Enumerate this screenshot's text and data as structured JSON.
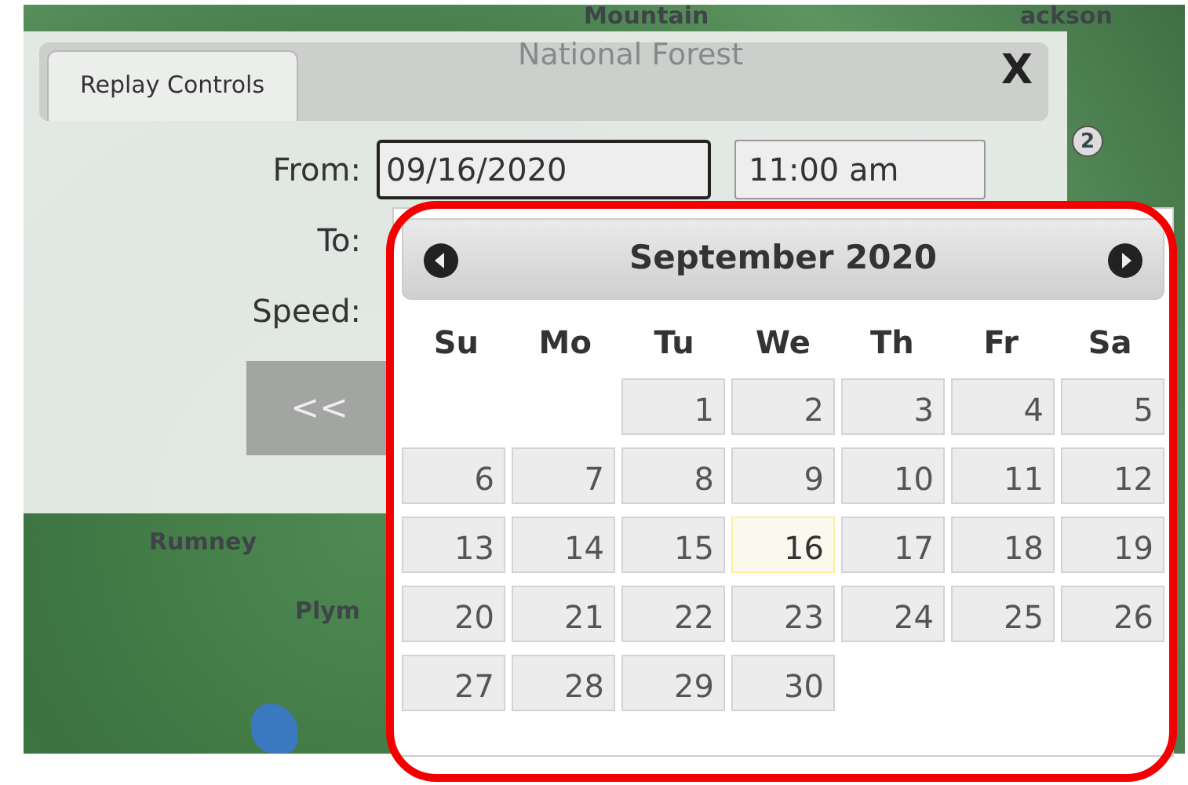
{
  "map": {
    "labels": [
      {
        "text": "Mountain",
        "kind": "place"
      },
      {
        "text": "National Forest",
        "kind": "area"
      },
      {
        "text": "ackson",
        "kind": "place"
      },
      {
        "text": "2",
        "kind": "shield"
      },
      {
        "text": "Rumney",
        "kind": "place"
      },
      {
        "text": "Plym",
        "kind": "place"
      }
    ]
  },
  "dialog": {
    "tabs": [
      {
        "label": "Replay Controls",
        "selected": true
      }
    ],
    "close": "X",
    "fields": [
      {
        "label": "From:",
        "date": "09/16/2020",
        "time": "11:00 am",
        "focused": true
      },
      {
        "label": "To:"
      },
      {
        "label": "Speed:"
      }
    ],
    "buttons": [
      "<<"
    ]
  },
  "datepicker": {
    "title": "September 2020",
    "weekdays": [
      "Su",
      "Mo",
      "Tu",
      "We",
      "Th",
      "Fr",
      "Sa"
    ],
    "weeks": [
      [
        {
          "kind": "empty"
        },
        {
          "kind": "empty"
        },
        {
          "day": "1",
          "selected": false
        },
        {
          "day": "2",
          "selected": false
        },
        {
          "day": "3",
          "selected": false
        },
        {
          "day": "4",
          "selected": false
        },
        {
          "day": "5",
          "selected": false
        }
      ],
      [
        {
          "day": "6",
          "selected": false
        },
        {
          "day": "7",
          "selected": false
        },
        {
          "day": "8",
          "selected": false
        },
        {
          "day": "9",
          "selected": false
        },
        {
          "day": "10",
          "selected": false
        },
        {
          "day": "11",
          "selected": false
        },
        {
          "day": "12",
          "selected": false
        }
      ],
      [
        {
          "day": "13",
          "selected": false
        },
        {
          "day": "14",
          "selected": false
        },
        {
          "day": "15",
          "selected": false
        },
        {
          "day": "16",
          "selected": true
        },
        {
          "day": "17",
          "selected": false
        },
        {
          "day": "18",
          "selected": false
        },
        {
          "day": "19",
          "selected": false
        }
      ],
      [
        {
          "day": "20",
          "selected": false
        },
        {
          "day": "21",
          "selected": false
        },
        {
          "day": "22",
          "selected": false
        },
        {
          "day": "23",
          "selected": false
        },
        {
          "day": "24",
          "selected": false
        },
        {
          "day": "25",
          "selected": false
        },
        {
          "day": "26",
          "selected": false
        }
      ],
      [
        {
          "day": "27",
          "selected": false
        },
        {
          "day": "28",
          "selected": false
        },
        {
          "day": "29",
          "selected": false
        },
        {
          "day": "30",
          "selected": false
        },
        {
          "kind": "empty"
        },
        {
          "kind": "empty"
        },
        {
          "kind": "empty"
        }
      ]
    ]
  },
  "annotation": {
    "highlighted": true
  }
}
